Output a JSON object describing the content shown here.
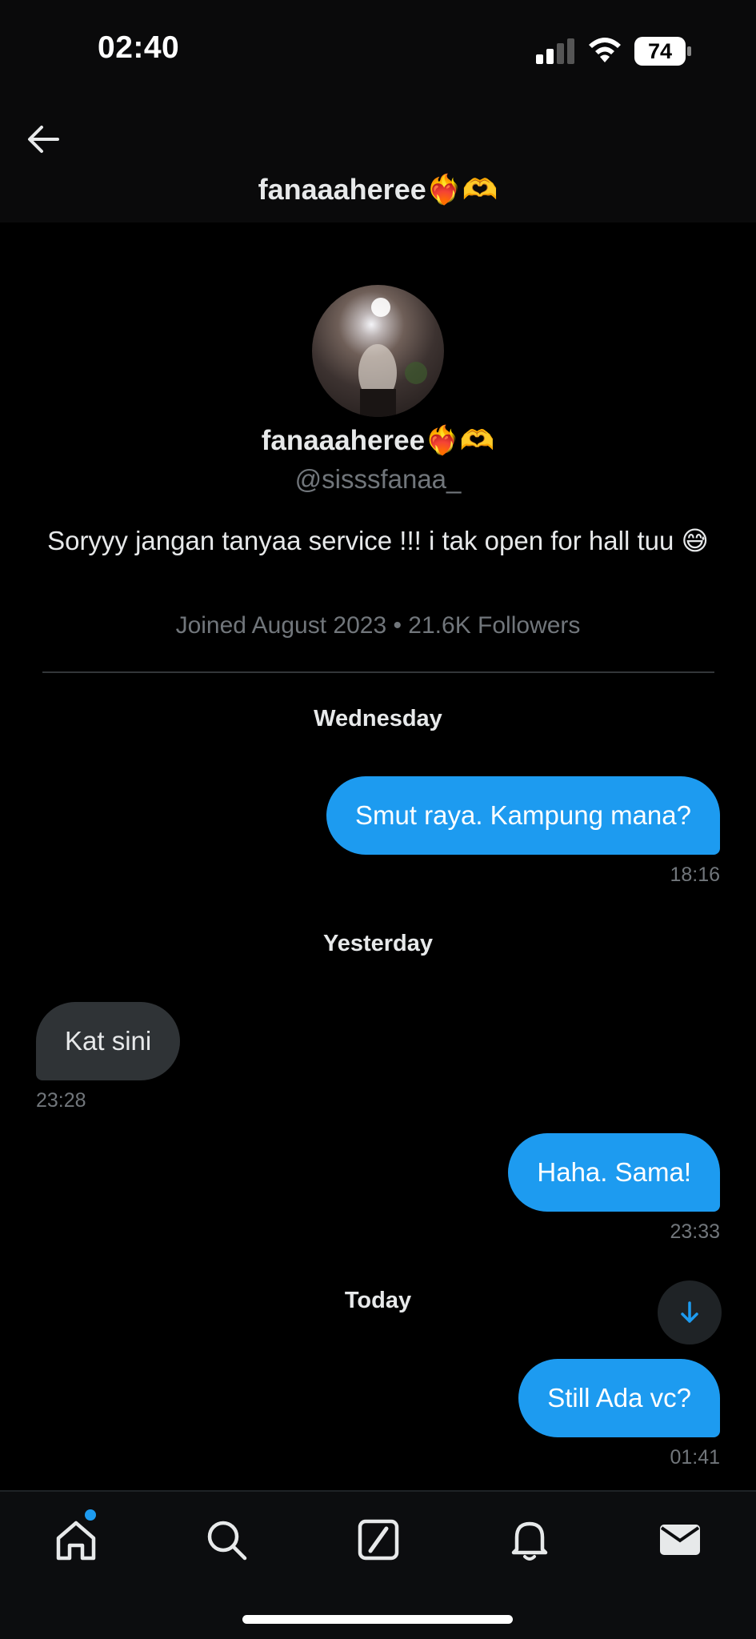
{
  "status_bar": {
    "time": "02:40",
    "battery": "74"
  },
  "header": {
    "title": "fanaaaheree❤️‍🔥🫶"
  },
  "profile": {
    "name": "fanaaaheree❤️‍🔥🫶",
    "handle": "@sisssfanaa_",
    "bio": "Soryyy jangan tanyaa service !!! i tak open for hall tuu 😅",
    "meta": "Joined August 2023 • 21.6K Followers"
  },
  "conversation": [
    {
      "day": "Wednesday",
      "messages": [
        {
          "direction": "sent",
          "text": "Smut raya. Kampung mana?",
          "time": "18:16"
        }
      ]
    },
    {
      "day": "Yesterday",
      "messages": [
        {
          "direction": "received",
          "text": "Kat sini",
          "time": "23:28"
        },
        {
          "direction": "sent",
          "text": "Haha. Sama!",
          "time": "23:33"
        }
      ]
    },
    {
      "day": "Today",
      "messages": [
        {
          "direction": "sent",
          "text": "Still Ada vc?",
          "time": "01:41"
        }
      ]
    }
  ],
  "nav": {
    "items": [
      "home-icon",
      "search-icon",
      "compose-icon",
      "notifications-icon",
      "messages-icon"
    ],
    "active": "home-icon"
  },
  "colors": {
    "accent": "#1d9bf0",
    "received_bubble": "#2f3336",
    "muted_text": "#71767b"
  }
}
